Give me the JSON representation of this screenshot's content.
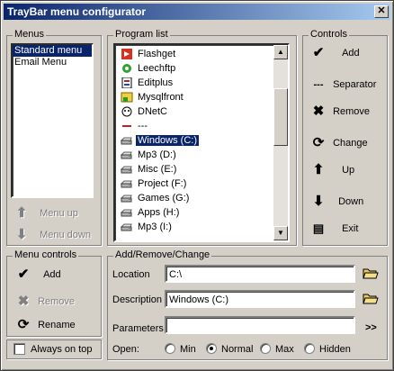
{
  "window": {
    "title": "TrayBar menu configurator",
    "close_label": "✕"
  },
  "menus": {
    "label": "Menus",
    "items": [
      {
        "label": "Standard menu",
        "selected": true
      },
      {
        "label": "Email Menu",
        "selected": false
      }
    ],
    "up_label": "Menu up",
    "down_label": "Menu down"
  },
  "program_list": {
    "label": "Program list",
    "items": [
      {
        "label": "Flashget",
        "icon": "flashget-icon"
      },
      {
        "label": "Leechftp",
        "icon": "leechftp-icon"
      },
      {
        "label": "Editplus",
        "icon": "editplus-icon"
      },
      {
        "label": "Mysqlfront",
        "icon": "mysqlfront-icon"
      },
      {
        "label": "DNetC",
        "icon": "dnetc-icon"
      },
      {
        "label": "---",
        "icon": "separator-icon"
      },
      {
        "label": "Windows (C:)",
        "icon": "drive-icon",
        "selected": true
      },
      {
        "label": "Mp3 (D:)",
        "icon": "drive-icon"
      },
      {
        "label": "Misc (E:)",
        "icon": "drive-icon"
      },
      {
        "label": "Project (F:)",
        "icon": "drive-icon"
      },
      {
        "label": "Games (G:)",
        "icon": "drive-icon"
      },
      {
        "label": "Apps (H:)",
        "icon": "drive-icon"
      },
      {
        "label": "Mp3 (I:)",
        "icon": "drive-icon"
      }
    ]
  },
  "controls": {
    "label": "Controls",
    "add": "Add",
    "separator": "Separator",
    "remove": "Remove",
    "change": "Change",
    "up": "Up",
    "down": "Down",
    "exit": "Exit"
  },
  "menu_controls": {
    "label": "Menu controls",
    "add": "Add",
    "remove": "Remove",
    "rename": "Rename"
  },
  "always_on_top": {
    "label": "Always on top",
    "checked": false
  },
  "edit_panel": {
    "label": "Add/Remove/Change",
    "location_label": "Location",
    "location_value": "C:\\",
    "description_label": "Description",
    "description_value": "Windows (C:)",
    "parameters_label": "Parameters",
    "parameters_value": "",
    "more_label": ">>",
    "open_label": "Open:",
    "open_options": [
      "Min",
      "Normal",
      "Max",
      "Hidden"
    ],
    "open_selected": "Normal"
  },
  "colors": {
    "selection": "#0a246a",
    "face": "#d4d0c8"
  }
}
